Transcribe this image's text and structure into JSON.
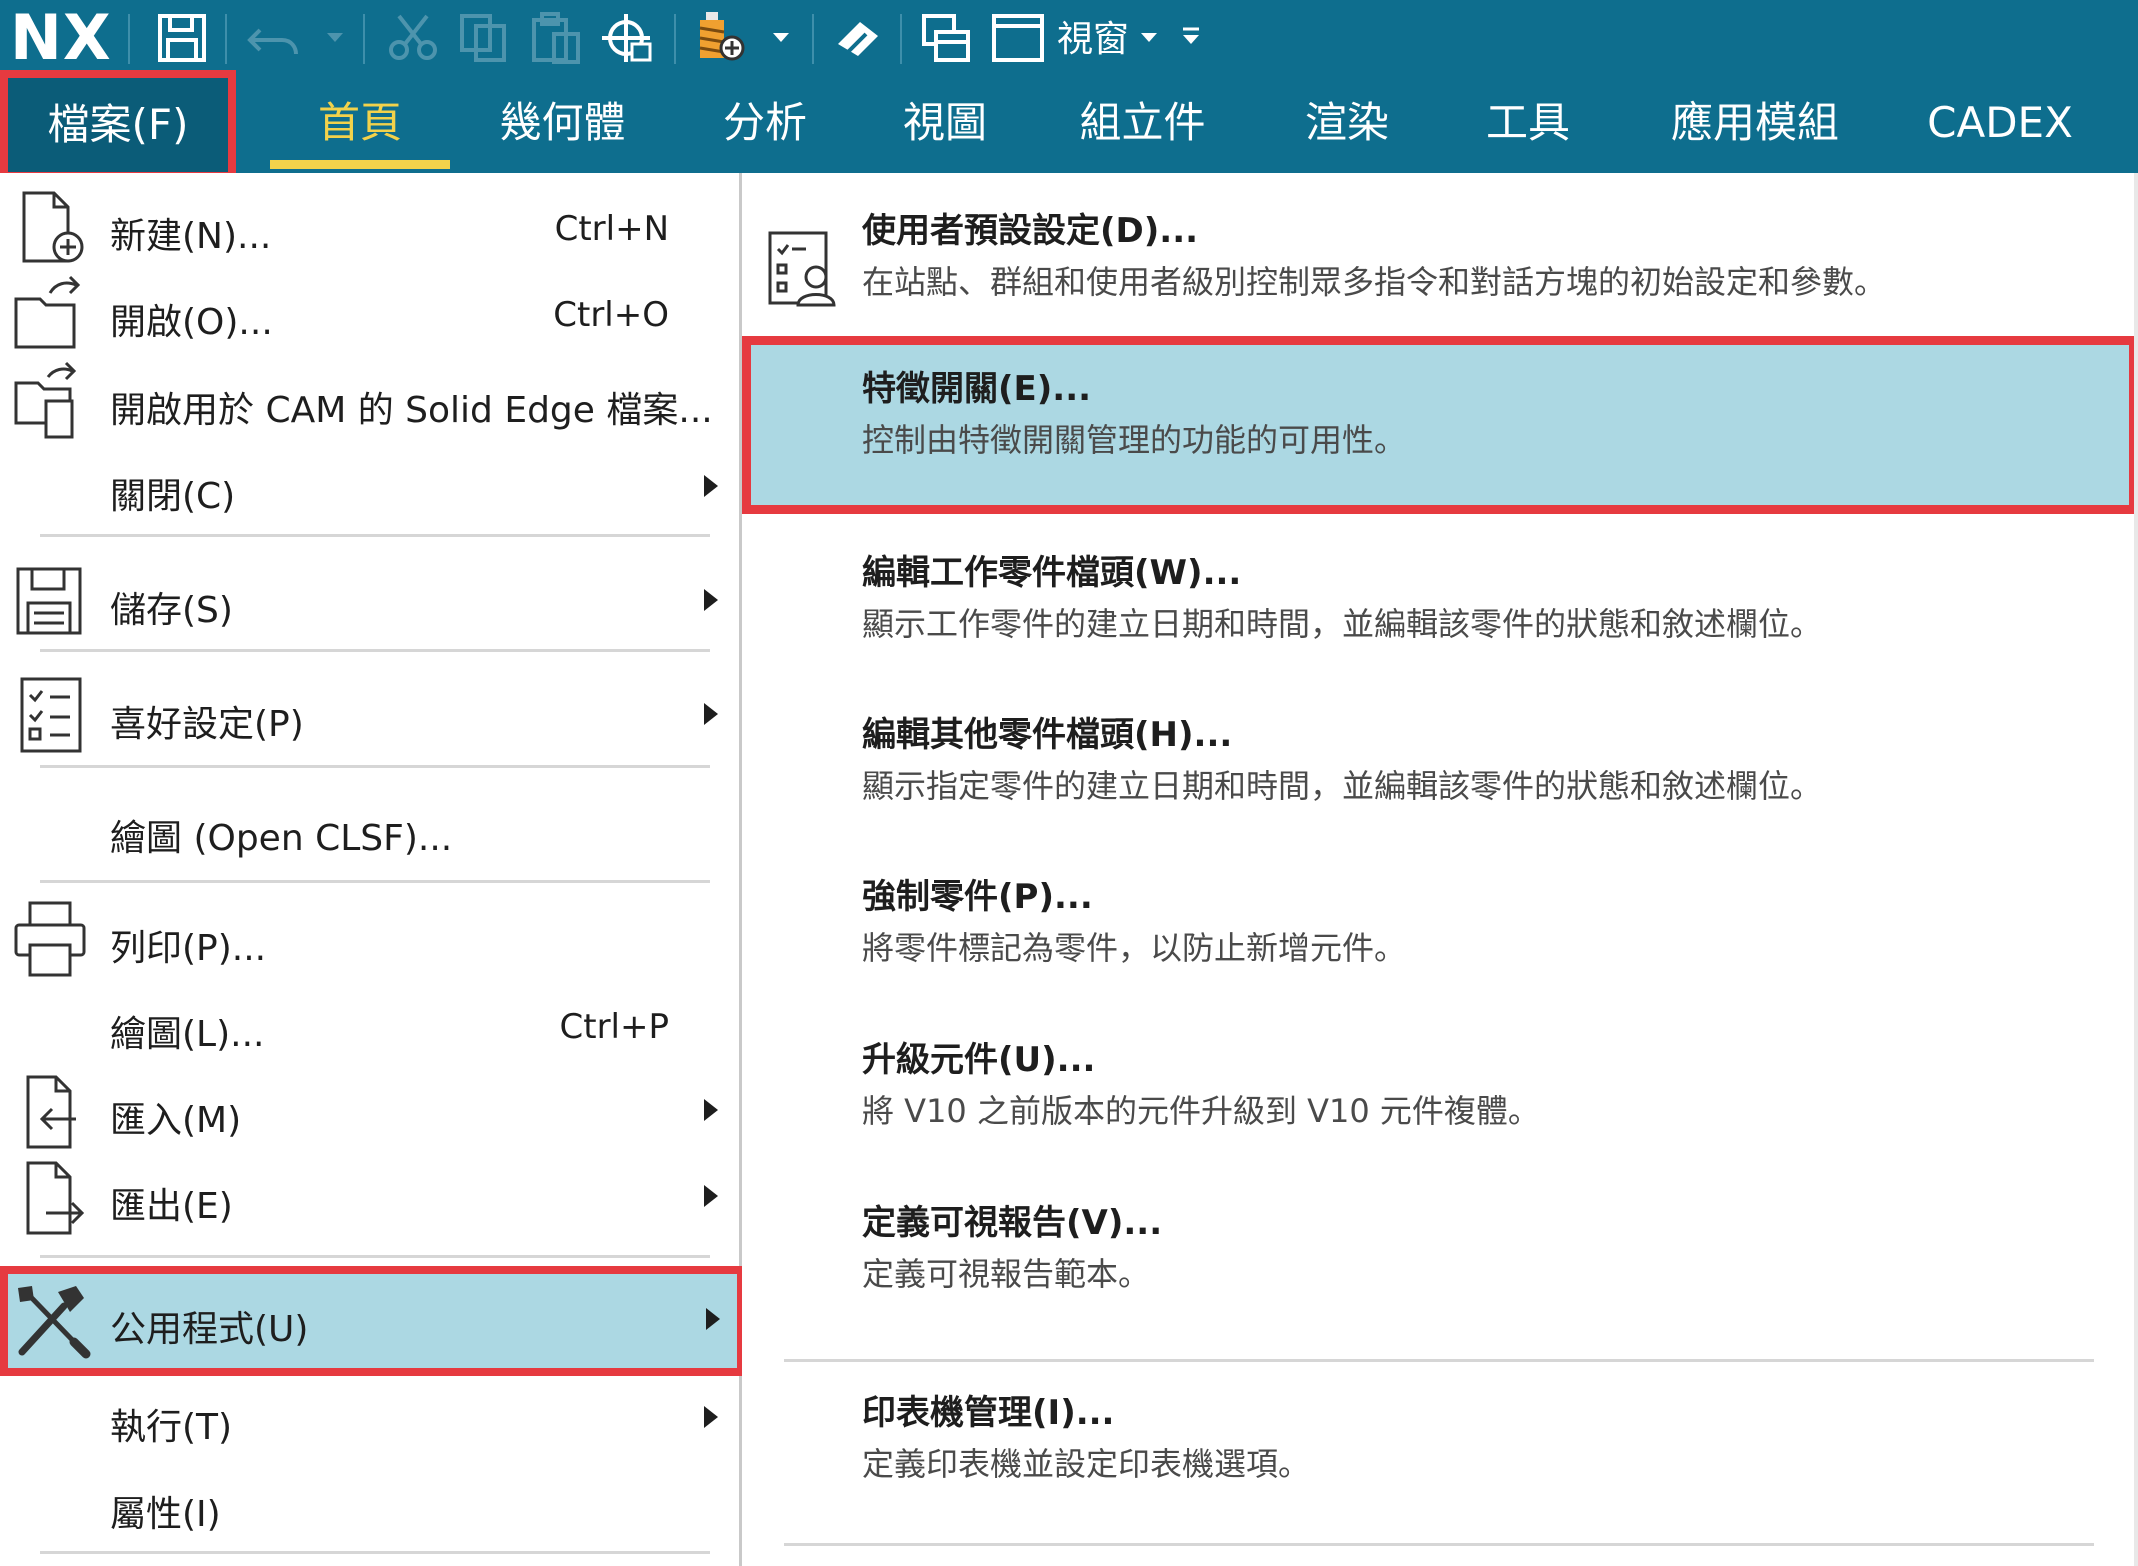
{
  "app": {
    "logo": "NX"
  },
  "quick_access": {
    "window_menu_label": "視窗"
  },
  "tabs": [
    {
      "label": "首頁"
    },
    {
      "label": "幾何體"
    },
    {
      "label": "分析"
    },
    {
      "label": "視圖"
    },
    {
      "label": "組立件"
    },
    {
      "label": "渲染"
    },
    {
      "label": "工具"
    },
    {
      "label": "應用模組"
    },
    {
      "label": "CADEX"
    }
  ],
  "file_tab": {
    "label": "檔案(F)"
  },
  "file_menu": {
    "items": [
      {
        "label": "新建(N)...",
        "shortcut": "Ctrl+N",
        "icon": "new-file-icon"
      },
      {
        "label": "開啟(O)...",
        "shortcut": "Ctrl+O",
        "icon": "open-folder-icon"
      },
      {
        "label": "開啟用於 CAM 的 Solid Edge 檔案...",
        "shortcut": "",
        "icon": "open-cam-icon"
      },
      {
        "label": "關閉(C)",
        "shortcut": "",
        "icon": ""
      },
      {
        "label": "儲存(S)",
        "shortcut": "",
        "icon": "save-icon"
      },
      {
        "label": "喜好設定(P)",
        "shortcut": "",
        "icon": "preferences-icon"
      },
      {
        "label": "繪圖 (Open CLSF)...",
        "shortcut": "",
        "icon": ""
      },
      {
        "label": "列印(P)...",
        "shortcut": "",
        "icon": "printer-icon"
      },
      {
        "label": "繪圖(L)...",
        "shortcut": "Ctrl+P",
        "icon": ""
      },
      {
        "label": "匯入(M)",
        "shortcut": "",
        "icon": "import-icon"
      },
      {
        "label": "匯出(E)",
        "shortcut": "",
        "icon": "export-icon"
      },
      {
        "label": "公用程式(U)",
        "shortcut": "",
        "icon": "tools-icon"
      },
      {
        "label": "執行(T)",
        "shortcut": "",
        "icon": ""
      },
      {
        "label": "屬性(I)",
        "shortcut": "",
        "icon": ""
      }
    ]
  },
  "submenu": {
    "items": [
      {
        "title": "使用者預設設定(D)...",
        "desc": "在站點、群組和使用者級別控制眾多指令和對話方塊的初始設定和參數。",
        "icon": "user-defaults-icon"
      },
      {
        "title": "特徵開關(E)...",
        "desc": "控制由特徵開關管理的功能的可用性。"
      },
      {
        "title": "編輯工作零件檔頭(W)...",
        "desc": "顯示工作零件的建立日期和時間，並編輯該零件的狀態和敘述欄位。"
      },
      {
        "title": "編輯其他零件檔頭(H)...",
        "desc": "顯示指定零件的建立日期和時間，並編輯該零件的狀態和敘述欄位。"
      },
      {
        "title": "強制零件(P)...",
        "desc": "將零件標記為零件，以防止新增元件。"
      },
      {
        "title": "升級元件(U)...",
        "desc": "將 V10 之前版本的元件升級到 V10 元件複體。"
      },
      {
        "title": "定義可視報告(V)...",
        "desc": "定義可視報告範本。"
      },
      {
        "title": "印表機管理(I)...",
        "desc": "定義印表機並設定印表機選項。"
      }
    ]
  },
  "colors": {
    "ribbon": "#0e6e8e",
    "active_tab": "#f2d24b",
    "highlight": "#acd8e3",
    "callout_border": "#e63a40"
  }
}
